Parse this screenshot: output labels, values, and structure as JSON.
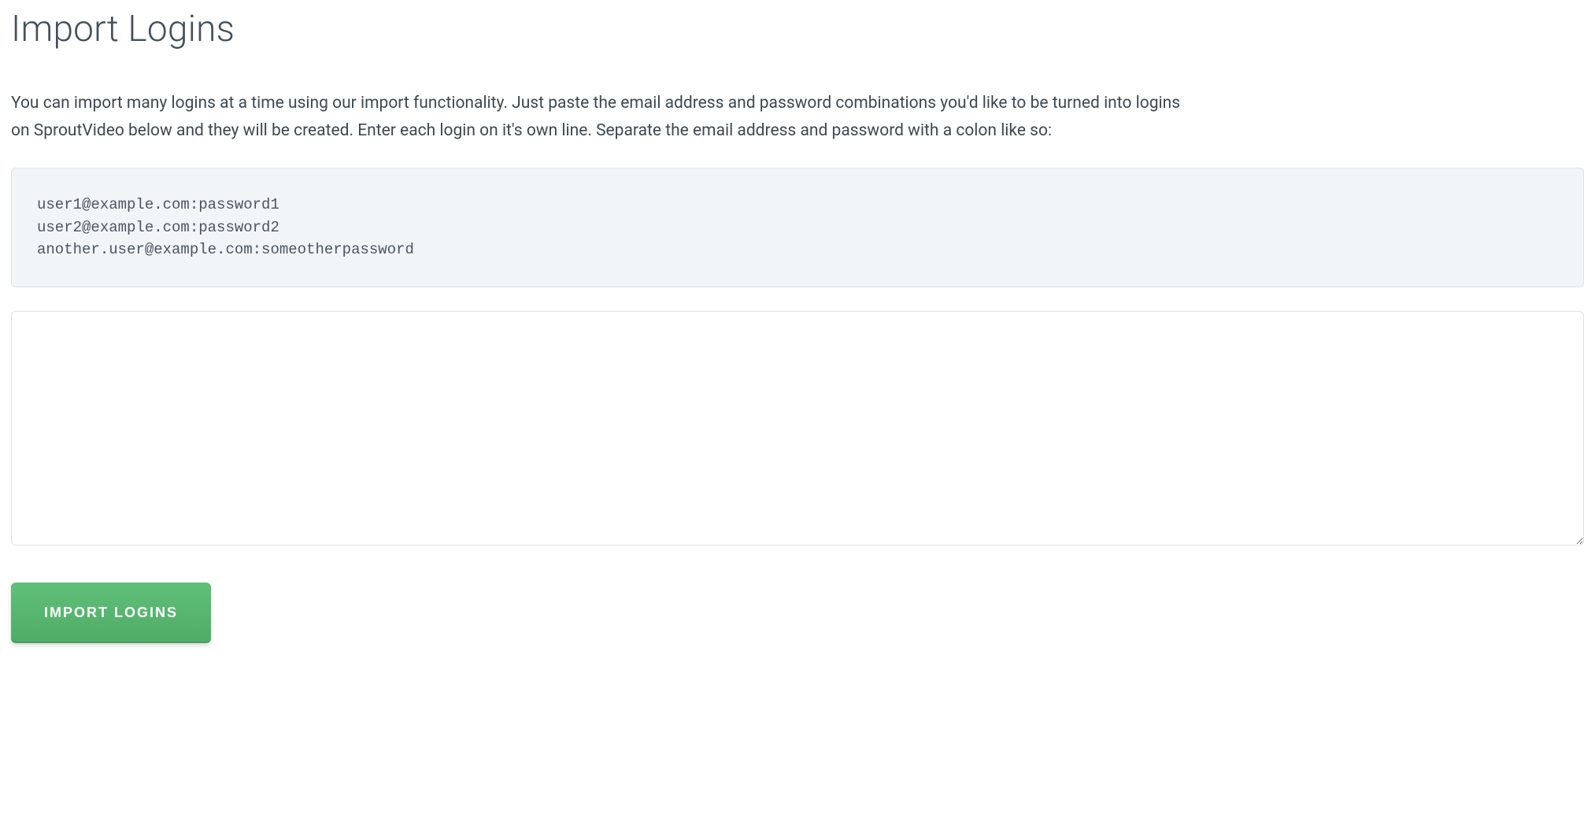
{
  "page": {
    "title": "Import Logins",
    "description": "You can import many logins at a time using our import functionality. Just paste the email address and password combinations you'd like to be turned into logins on SproutVideo below and they will be created. Enter each login on it's own line. Separate the email address and password with a colon like so:",
    "example_text": "user1@example.com:password1\nuser2@example.com:password2\nanother.user@example.com:someotherpassword",
    "textarea_value": "",
    "textarea_placeholder": "",
    "button_label": "IMPORT LOGINS"
  }
}
